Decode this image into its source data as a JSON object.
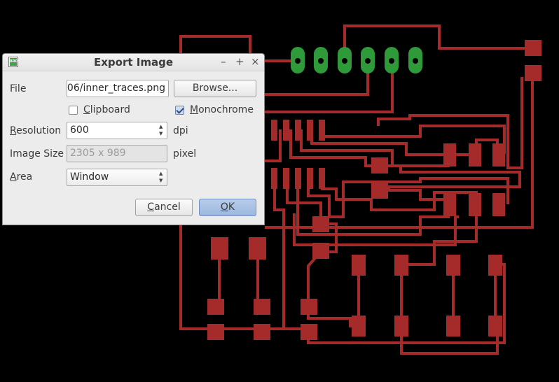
{
  "dialog": {
    "title": "Export Image",
    "app_icon_text": "BRD",
    "window_buttons": {
      "minimize": "–",
      "maximize": "+",
      "close": "×"
    },
    "file": {
      "label": "File",
      "value": "…/06/inner_traces.png",
      "browse_label": "Browse..."
    },
    "clipboard": {
      "label": "Clipboard",
      "checked": false
    },
    "monochrome": {
      "label": "Monochrome",
      "checked": true
    },
    "resolution": {
      "label": "Resolution",
      "value": "600",
      "unit": "dpi"
    },
    "image_size": {
      "label": "Image Size",
      "value": "2305 x 989",
      "unit": "pixel"
    },
    "area": {
      "label": "Area",
      "value": "Window"
    },
    "cancel_label": "Cancel",
    "ok_label": "OK"
  },
  "colors": {
    "trace": "#a52a2a",
    "pad_green": "#2f9a3a",
    "background": "#000000"
  }
}
